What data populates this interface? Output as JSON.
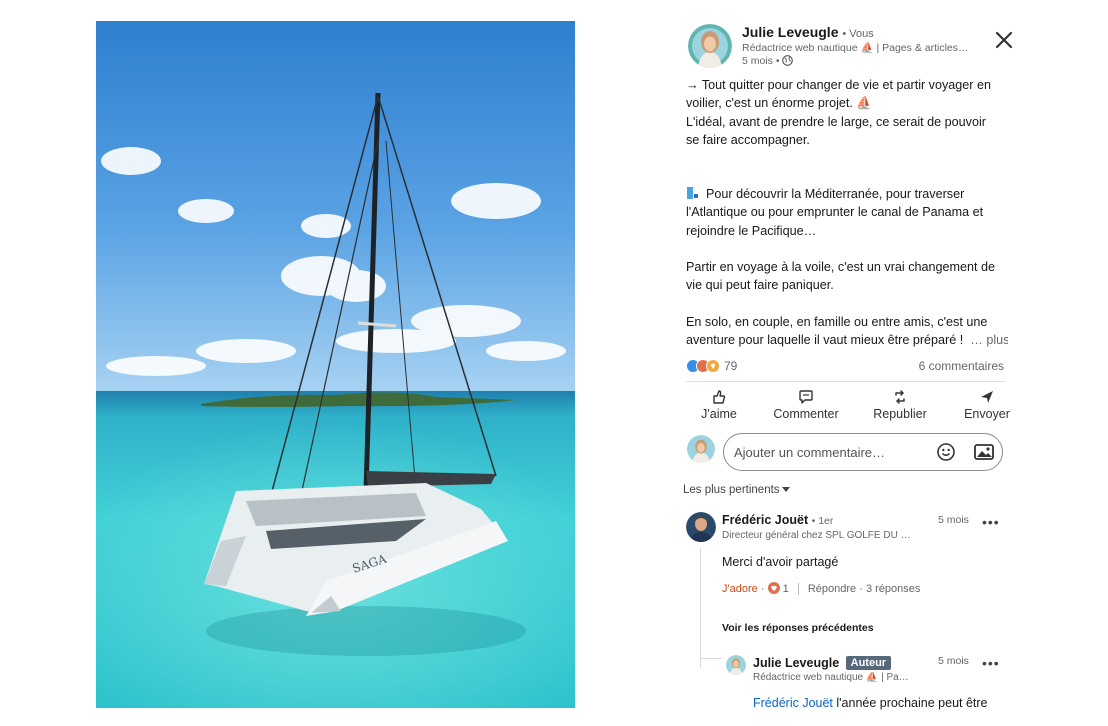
{
  "post": {
    "author": {
      "name": "Julie Leveugle",
      "you_label": "• Vous",
      "title": "Rédactrice web nautique ⛵ | Pages & articles…",
      "time": "5 mois •"
    },
    "body": {
      "p1": "→ Tout quitter pour changer de vie et partir voyager en",
      "p2": "voilier, c'est un énorme projet. ⛵",
      "p3": "L'idéal, avant de prendre le large, ce serait de pouvoir",
      "p4": "se faire accompagner.",
      "p5": "Pour découvrir la Méditerranée, pour traverser",
      "p6": "l'Atlantique ou pour emprunter le canal de Panama et",
      "p7": "rejoindre le Pacifique…",
      "p8": "Partir en voyage à la voile, c'est un vrai changement de",
      "p9": "vie qui peut faire paniquer.",
      "p10": "En solo, en couple, en famille ou entre amis, c'est une",
      "p11": "aventure pour laquelle il vaut mieux être préparé !",
      "more": "… plus"
    },
    "reactions_count": "79",
    "comments_count": "6 commentaires"
  },
  "actions": {
    "like": "J'aime",
    "comment": "Commenter",
    "repost": "Republier",
    "send": "Envoyer"
  },
  "comment_box": {
    "placeholder": "Ajouter un commentaire…"
  },
  "sort_label": "Les plus pertinents",
  "comments": [
    {
      "name": "Frédéric Jouët",
      "degree": "• 1er",
      "title": "Directeur général chez SPL GOLFE DU …",
      "time": "5 mois",
      "text": "Merci d'avoir partagé",
      "reaction_label": "J'adore",
      "reaction_sep": "·",
      "reaction_count": "1",
      "reply_label": "Répondre",
      "replies": "· 3 réponses"
    }
  ],
  "previous_replies": "Voir les réponses précédentes",
  "reply": {
    "name": "Julie Leveugle",
    "badge": "Auteur",
    "title": "Rédactrice web nautique ⛵ | Pa…",
    "time": "5 mois",
    "mention": "Frédéric Jouët",
    "text": "l'année prochaine peut être"
  },
  "boat_name": "SAGA",
  "colors": {
    "brand_blue": "#0a66c2",
    "love_red": "#c64a16",
    "text": "#191919",
    "muted": "#666666"
  }
}
